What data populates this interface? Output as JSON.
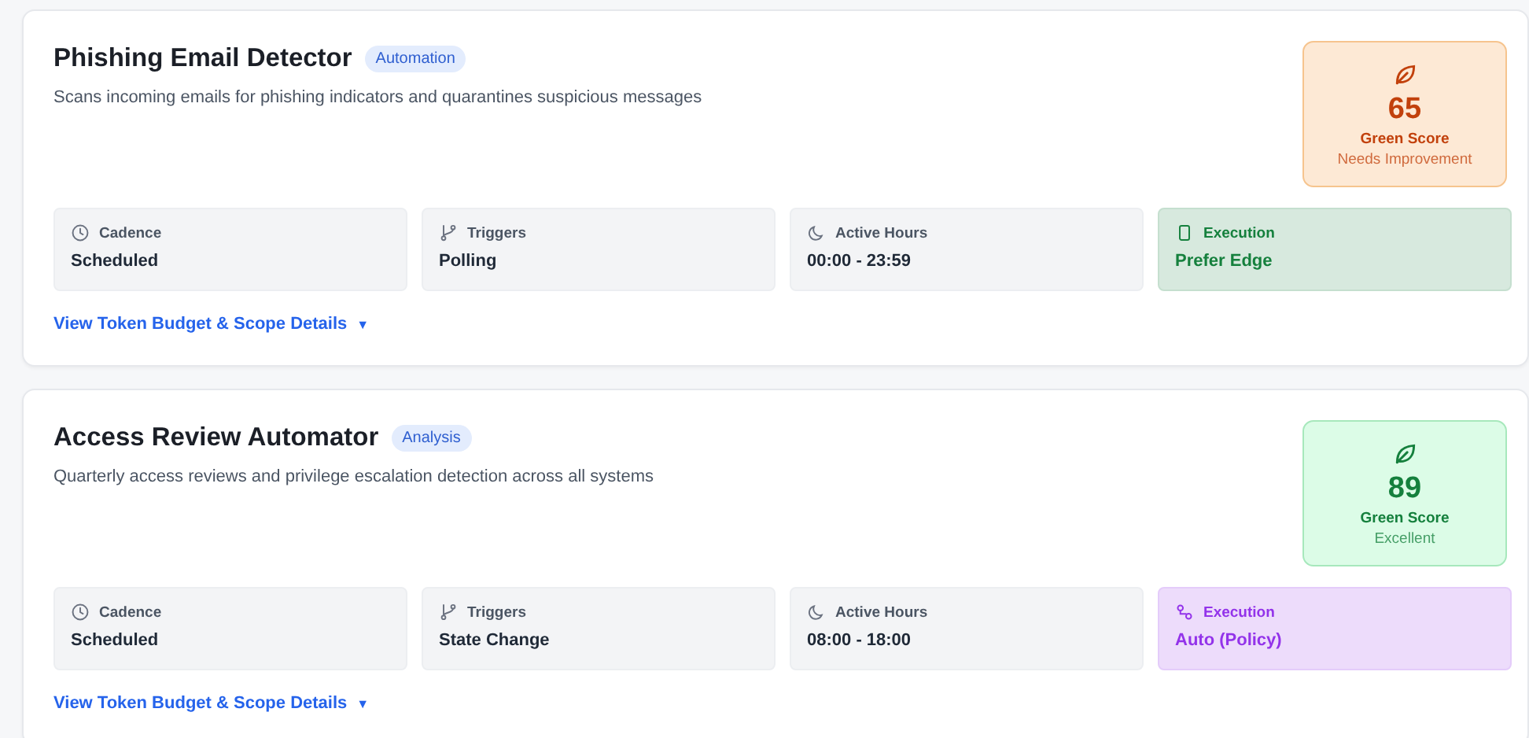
{
  "cards": [
    {
      "title": "Phishing Email Detector",
      "tag": "Automation",
      "description": "Scans incoming emails for phishing indicators and quarantines suspicious messages",
      "score": {
        "kind": "warning",
        "value": "65",
        "label": "Green Score",
        "rating": "Needs Improvement"
      },
      "tiles": [
        {
          "kind": "clock",
          "highlighted": false,
          "color": "#1f2937",
          "label": "Cadence",
          "value": "Scheduled"
        },
        {
          "kind": "branch",
          "highlighted": false,
          "color": "#1f2937",
          "label": "Triggers",
          "value": "Polling"
        },
        {
          "kind": "moon",
          "highlighted": false,
          "color": "#1f2937",
          "label": "Active Hours",
          "value": "00:00 - 23:59"
        },
        {
          "kind": "device",
          "highlighted": true,
          "color": "#15803d",
          "label": "Execution",
          "value": "Prefer Edge"
        }
      ],
      "link": "View Token Budget & Scope Details",
      "link_caret": "▼"
    },
    {
      "title": "Access Review Automator",
      "tag": "Analysis",
      "description": "Quarterly access reviews and privilege escalation detection across all systems",
      "score": {
        "kind": "good",
        "value": "89",
        "label": "Green Score",
        "rating": "Excellent"
      },
      "tiles": [
        {
          "kind": "clock",
          "highlighted": false,
          "color": "#1f2937",
          "label": "Cadence",
          "value": "Scheduled"
        },
        {
          "kind": "branch",
          "highlighted": false,
          "color": "#1f2937",
          "label": "Triggers",
          "value": "State Change"
        },
        {
          "kind": "moon",
          "highlighted": false,
          "color": "#1f2937",
          "label": "Active Hours",
          "value": "08:00 - 18:00"
        },
        {
          "kind": "route",
          "highlighted": true,
          "color": "#9333ea",
          "label": "Execution",
          "value": "Auto (Policy)"
        }
      ],
      "link": "View Token Budget & Scope Details",
      "link_caret": "▼"
    }
  ]
}
